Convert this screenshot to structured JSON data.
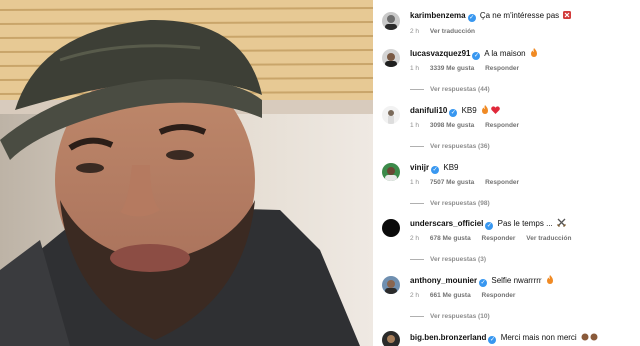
{
  "post": {
    "author": "karimbenzema",
    "caption": "Ça ne m'intéresse pas",
    "time": "2 h",
    "translate": "Ver traducción",
    "image_alt": "selfie photo"
  },
  "comments": [
    {
      "user": "lucasvazquez91",
      "text": "A la maison",
      "emoji": "fire",
      "time": "1 h",
      "likes": "3339 Me gusta",
      "reply": "Responder",
      "replies": "Ver respuestas (44)"
    },
    {
      "user": "danifuli10",
      "text": "KB9",
      "emoji": "fire-heart",
      "time": "1 h",
      "likes": "3098 Me gusta",
      "reply": "Responder",
      "replies": "Ver respuestas (36)"
    },
    {
      "user": "vinijr",
      "text": "KB9",
      "emoji": "",
      "time": "1 h",
      "likes": "7507 Me gusta",
      "reply": "Responder",
      "replies": "Ver respuestas (98)"
    },
    {
      "user": "underscars_officiel",
      "text": "Pas le temps ...",
      "emoji": "swords",
      "time": "2 h",
      "likes": "678 Me gusta",
      "reply": "Responder",
      "translate": "Ver traducción",
      "replies": "Ver respuestas (3)"
    },
    {
      "user": "anthony_mounier",
      "text": "Selfie nwarrrrr",
      "emoji": "fire",
      "time": "2 h",
      "likes": "661 Me gusta",
      "reply": "Responder",
      "replies": "Ver respuestas (10)"
    },
    {
      "user": "big.ben.bronzerland",
      "text": "Merci mais non merci",
      "emoji": "hands",
      "time": "",
      "likes": "",
      "reply": "",
      "replies": ""
    }
  ]
}
